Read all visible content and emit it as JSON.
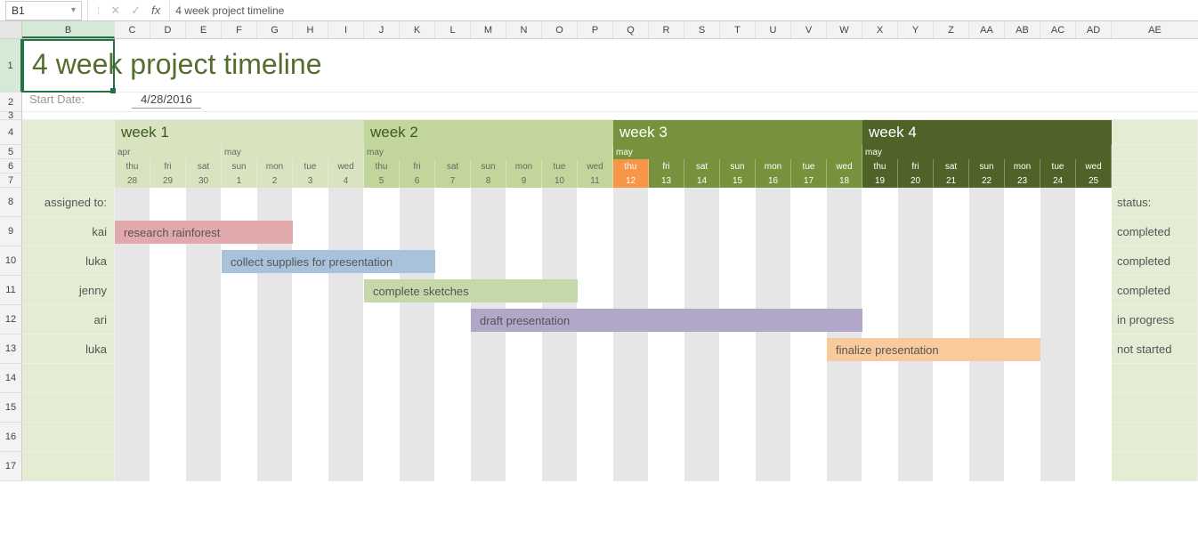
{
  "nameBox": "B1",
  "formula": "4 week project timeline",
  "title": "4 week project timeline",
  "startLabel": "Start Date:",
  "startDate": "4/28/2016",
  "columns": [
    "B",
    "C",
    "D",
    "E",
    "F",
    "G",
    "H",
    "I",
    "J",
    "K",
    "L",
    "M",
    "N",
    "O",
    "P",
    "Q",
    "R",
    "S",
    "T",
    "U",
    "V",
    "W",
    "X",
    "Y",
    "Z",
    "AA",
    "AB",
    "AC",
    "AD",
    "AE"
  ],
  "rowNums": [
    "1",
    "2",
    "3",
    "4",
    "5",
    "6",
    "7",
    "8",
    "9",
    "10",
    "11",
    "12",
    "13",
    "14",
    "15",
    "16",
    "17"
  ],
  "weeks": {
    "w1": "week 1",
    "w2": "week 2",
    "w3": "week 3",
    "w4": "week 4"
  },
  "months": {
    "m1": "apr",
    "m2": "may",
    "m3": "may",
    "m4": "may",
    "m5": "may"
  },
  "dows": [
    "thu",
    "fri",
    "sat",
    "sun",
    "mon",
    "tue",
    "wed",
    "thu",
    "fri",
    "sat",
    "sun",
    "mon",
    "tue",
    "wed",
    "thu",
    "fri",
    "sat",
    "sun",
    "mon",
    "tue",
    "wed",
    "thu",
    "fri",
    "sat",
    "sun",
    "mon",
    "tue",
    "wed"
  ],
  "dates": [
    "28",
    "29",
    "30",
    "1",
    "2",
    "3",
    "4",
    "5",
    "6",
    "7",
    "8",
    "9",
    "10",
    "11",
    "12",
    "13",
    "14",
    "15",
    "16",
    "17",
    "18",
    "19",
    "20",
    "21",
    "22",
    "23",
    "24",
    "25"
  ],
  "assignHeader": "assigned to:",
  "statusHeader": "status:",
  "tasks": [
    {
      "assignee": "kai",
      "label": "research rainforest",
      "status": "completed",
      "start": 0,
      "span": 5,
      "cls": "bar-red"
    },
    {
      "assignee": "luka",
      "label": "collect supplies for presentation",
      "status": "completed",
      "start": 3,
      "span": 6,
      "cls": "bar-blue"
    },
    {
      "assignee": "jenny",
      "label": "complete sketches",
      "status": "completed",
      "start": 7,
      "span": 6,
      "cls": "bar-green"
    },
    {
      "assignee": "ari",
      "label": "draft presentation",
      "status": "in progress",
      "start": 10,
      "span": 11,
      "cls": "bar-purple"
    },
    {
      "assignee": "luka",
      "label": "finalize presentation",
      "status": "not started",
      "start": 20,
      "span": 6,
      "cls": "bar-orange"
    }
  ],
  "todayIndex": 14
}
